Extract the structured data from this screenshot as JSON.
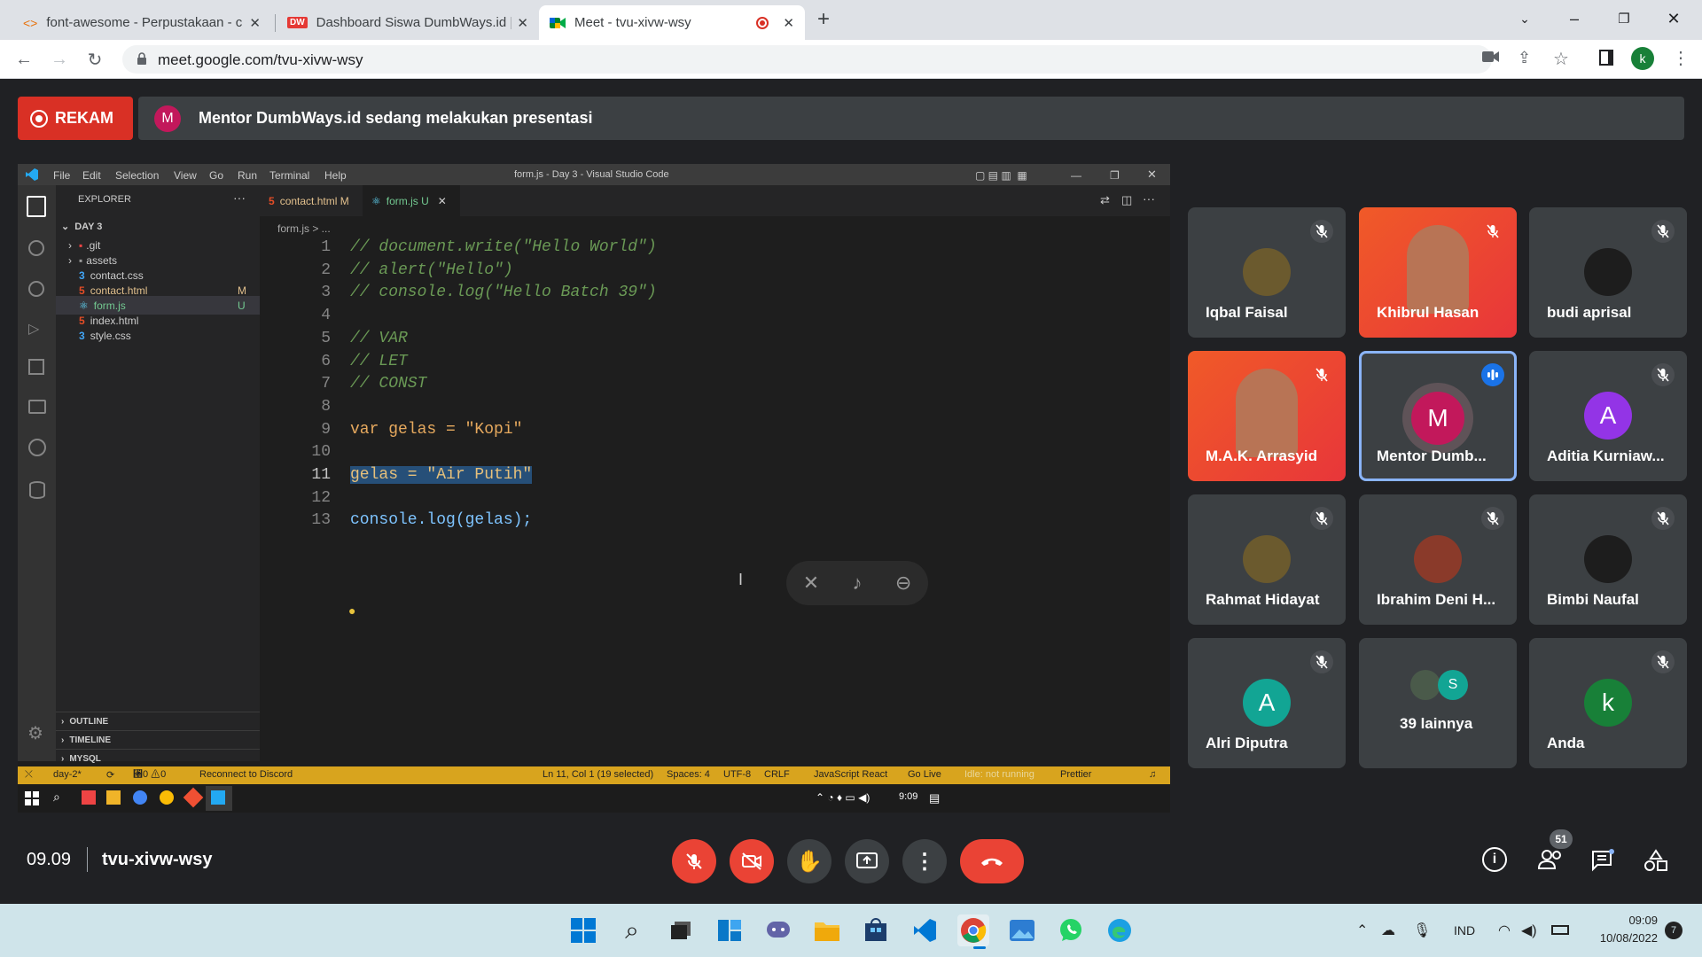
{
  "browser": {
    "tabs": [
      {
        "title": "font-awesome - Perpustakaan - c",
        "favicon": "back-forward-code-icon",
        "active": false
      },
      {
        "title": "Dashboard Siswa DumbWays.id |",
        "favicon": "dumbways-logo-icon",
        "badge": "DW",
        "active": false
      },
      {
        "title": "Meet - tvu-xivw-wsy",
        "favicon": "google-meet-icon",
        "active": true
      }
    ],
    "new_tab": "+",
    "url": "meet.google.com/tvu-xivw-wsy",
    "profile_initial": "k"
  },
  "meet": {
    "record_label": "REKAM",
    "presenter_initial": "M",
    "presenting_text": "Mentor DumbWays.id sedang melakukan presentasi",
    "time": "09.09",
    "meeting_code": "tvu-xivw-wsy",
    "participant_count": "51",
    "colors": {
      "end_call": "#ea4335",
      "mic_off": "#ea4335",
      "speaking_border": "#8ab4f8"
    },
    "participants": [
      {
        "name": "Iqbal Faisal",
        "muted": true,
        "type": "photo"
      },
      {
        "name": "Khibrul Hasan",
        "muted": true,
        "type": "video"
      },
      {
        "name": "budi aprisal",
        "muted": true,
        "type": "photo"
      },
      {
        "name": "M.A.K. Arrasyid",
        "muted": true,
        "type": "video"
      },
      {
        "name": "Mentor Dumb...",
        "initial": "M",
        "speaking": true,
        "color": "#c2185b"
      },
      {
        "name": "Aditia Kurniaw...",
        "initial": "A",
        "muted": true,
        "color": "#9334e6"
      },
      {
        "name": "Rahmat Hidayat",
        "muted": true,
        "type": "photo"
      },
      {
        "name": "Ibrahim Deni H...",
        "muted": true,
        "type": "photo"
      },
      {
        "name": "Bimbi Naufal",
        "muted": true,
        "type": "photo"
      },
      {
        "name": "Alri Diputra",
        "initial": "A",
        "muted": true,
        "color": "#12a594"
      },
      {
        "name": "39 lainnya",
        "initial": "S",
        "color": "#12a594"
      },
      {
        "name": "Anda",
        "initial": "k",
        "muted": true,
        "color": "#188038"
      }
    ]
  },
  "vscode": {
    "window_title": "form.js - Day 3 - Visual Studio Code",
    "menu": [
      "File",
      "Edit",
      "Selection",
      "View",
      "Go",
      "Run",
      "Terminal",
      "Help"
    ],
    "explorer_title": "EXPLORER",
    "folder": "DAY 3",
    "files": [
      {
        "name": ".git",
        "kind": "folder"
      },
      {
        "name": "assets",
        "kind": "folder"
      },
      {
        "name": "contact.css",
        "kind": "css"
      },
      {
        "name": "contact.html",
        "kind": "html",
        "badge": "M"
      },
      {
        "name": "form.js",
        "kind": "js",
        "badge": "U",
        "selected": true
      },
      {
        "name": "index.html",
        "kind": "html"
      },
      {
        "name": "style.css",
        "kind": "css"
      }
    ],
    "panels": [
      "OUTLINE",
      "TIMELINE",
      "MYSQL"
    ],
    "editor_tabs": [
      {
        "name": "contact.html",
        "badge": "M"
      },
      {
        "name": "form.js",
        "badge": "U",
        "active": true
      }
    ],
    "breadcrumb": "form.js > ...",
    "code": [
      "// document.write(\"Hello World\")",
      "// alert(\"Hello\")",
      "// console.log(\"Hello Batch 39\")",
      "",
      "// VAR",
      "// LET",
      "// CONST",
      "",
      "var gelas = \"Kopi\"",
      "",
      "gelas = \"Air Putih\"",
      "",
      "console.log(gelas);"
    ],
    "status": {
      "branch": "day-2*",
      "problems": "⑘0 ⚠0",
      "discord": "Reconnect to Discord",
      "position": "Ln 11, Col 1 (19 selected)",
      "spaces": "Spaces: 4",
      "encoding": "UTF-8",
      "eol": "CRLF",
      "language": "JavaScript React",
      "golive": "Go Live",
      "idle": "Idle: not running",
      "prettier": "Prettier"
    },
    "taskbar_clock": "9:09"
  },
  "taskbar": {
    "lang": "IND",
    "time": "09:09",
    "date": "10/08/2022",
    "notifications": "7"
  }
}
